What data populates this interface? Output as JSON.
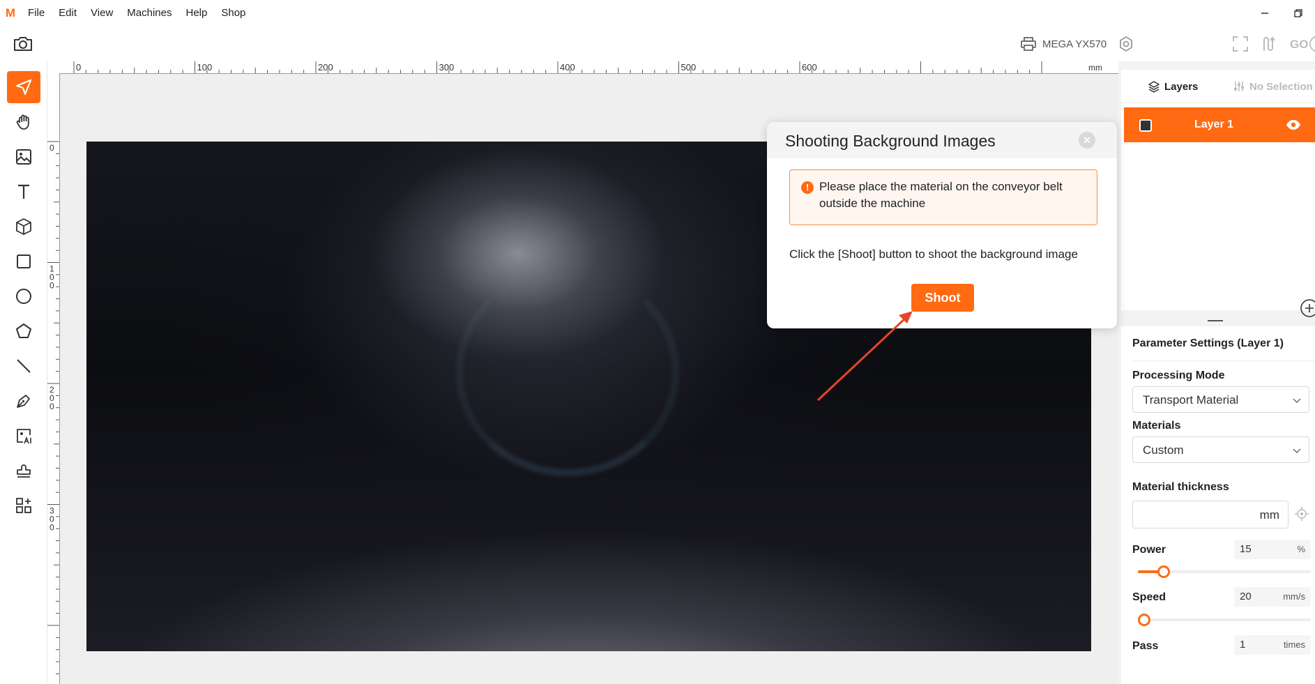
{
  "menubar": {
    "logo": "M",
    "items": [
      "File",
      "Edit",
      "View",
      "Machines",
      "Help",
      "Shop"
    ]
  },
  "toolbar": {
    "machine_name": "MEGA YX570",
    "go_label": "GO"
  },
  "rulers": {
    "top_labels": [
      "0",
      "100",
      "200",
      "300",
      "400",
      "500",
      "600",
      "mm"
    ],
    "left_labels": [
      "0",
      "100",
      "200",
      "300"
    ]
  },
  "layers": {
    "tab_layers": "Layers",
    "tab_no_selection": "No Selection",
    "items": [
      {
        "name": "Layer 1"
      }
    ]
  },
  "params": {
    "title": "Parameter Settings (Layer 1)",
    "processing_mode_label": "Processing Mode",
    "processing_mode_value": "Transport Material",
    "materials_label": "Materials",
    "materials_value": "Custom",
    "thickness_label": "Material thickness",
    "thickness_unit": "mm",
    "power_label": "Power",
    "power_value": "15",
    "power_unit": "%",
    "power_fraction": 0.15,
    "speed_label": "Speed",
    "speed_value": "20",
    "speed_unit": "mm/s",
    "speed_fraction": 0.0,
    "pass_label": "Pass",
    "pass_value": "1",
    "pass_unit": "times"
  },
  "dialog": {
    "title": "Shooting Background Images",
    "warning_icon": "!",
    "warning": "Please place the material on the conveyor belt outside the machine",
    "instruction": "Click the [Shoot] button to shoot the background image",
    "shoot_label": "Shoot"
  },
  "colors": {
    "accent": "#ff6a13",
    "annotation_arrow": "#e8442a"
  }
}
